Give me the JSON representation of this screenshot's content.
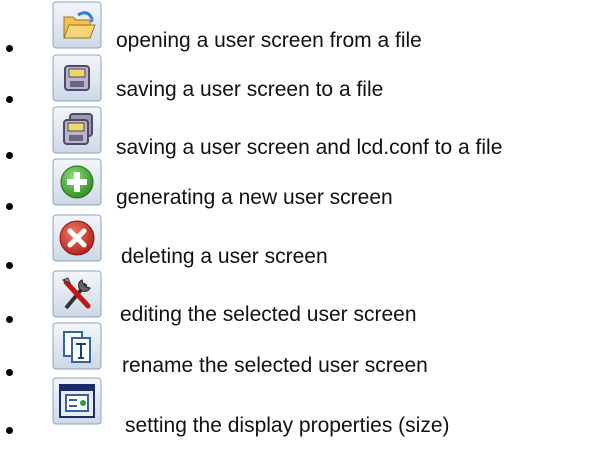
{
  "items": [
    {
      "icon": "open-folder-icon",
      "label": "opening a user screen from a file"
    },
    {
      "icon": "save-disk-icon",
      "label": "saving a user screen to a file"
    },
    {
      "icon": "save-all-disks-icon",
      "label": "saving a user screen and lcd.conf to a file"
    },
    {
      "icon": "green-plus-icon",
      "label": "generating a new user screen"
    },
    {
      "icon": "red-x-icon",
      "label": "deleting a user screen"
    },
    {
      "icon": "tools-icon",
      "label": "editing the selected user screen"
    },
    {
      "icon": "rename-icon",
      "label": "rename the selected user screen"
    },
    {
      "icon": "display-properties-icon",
      "label": "setting the display properties (size)"
    }
  ]
}
